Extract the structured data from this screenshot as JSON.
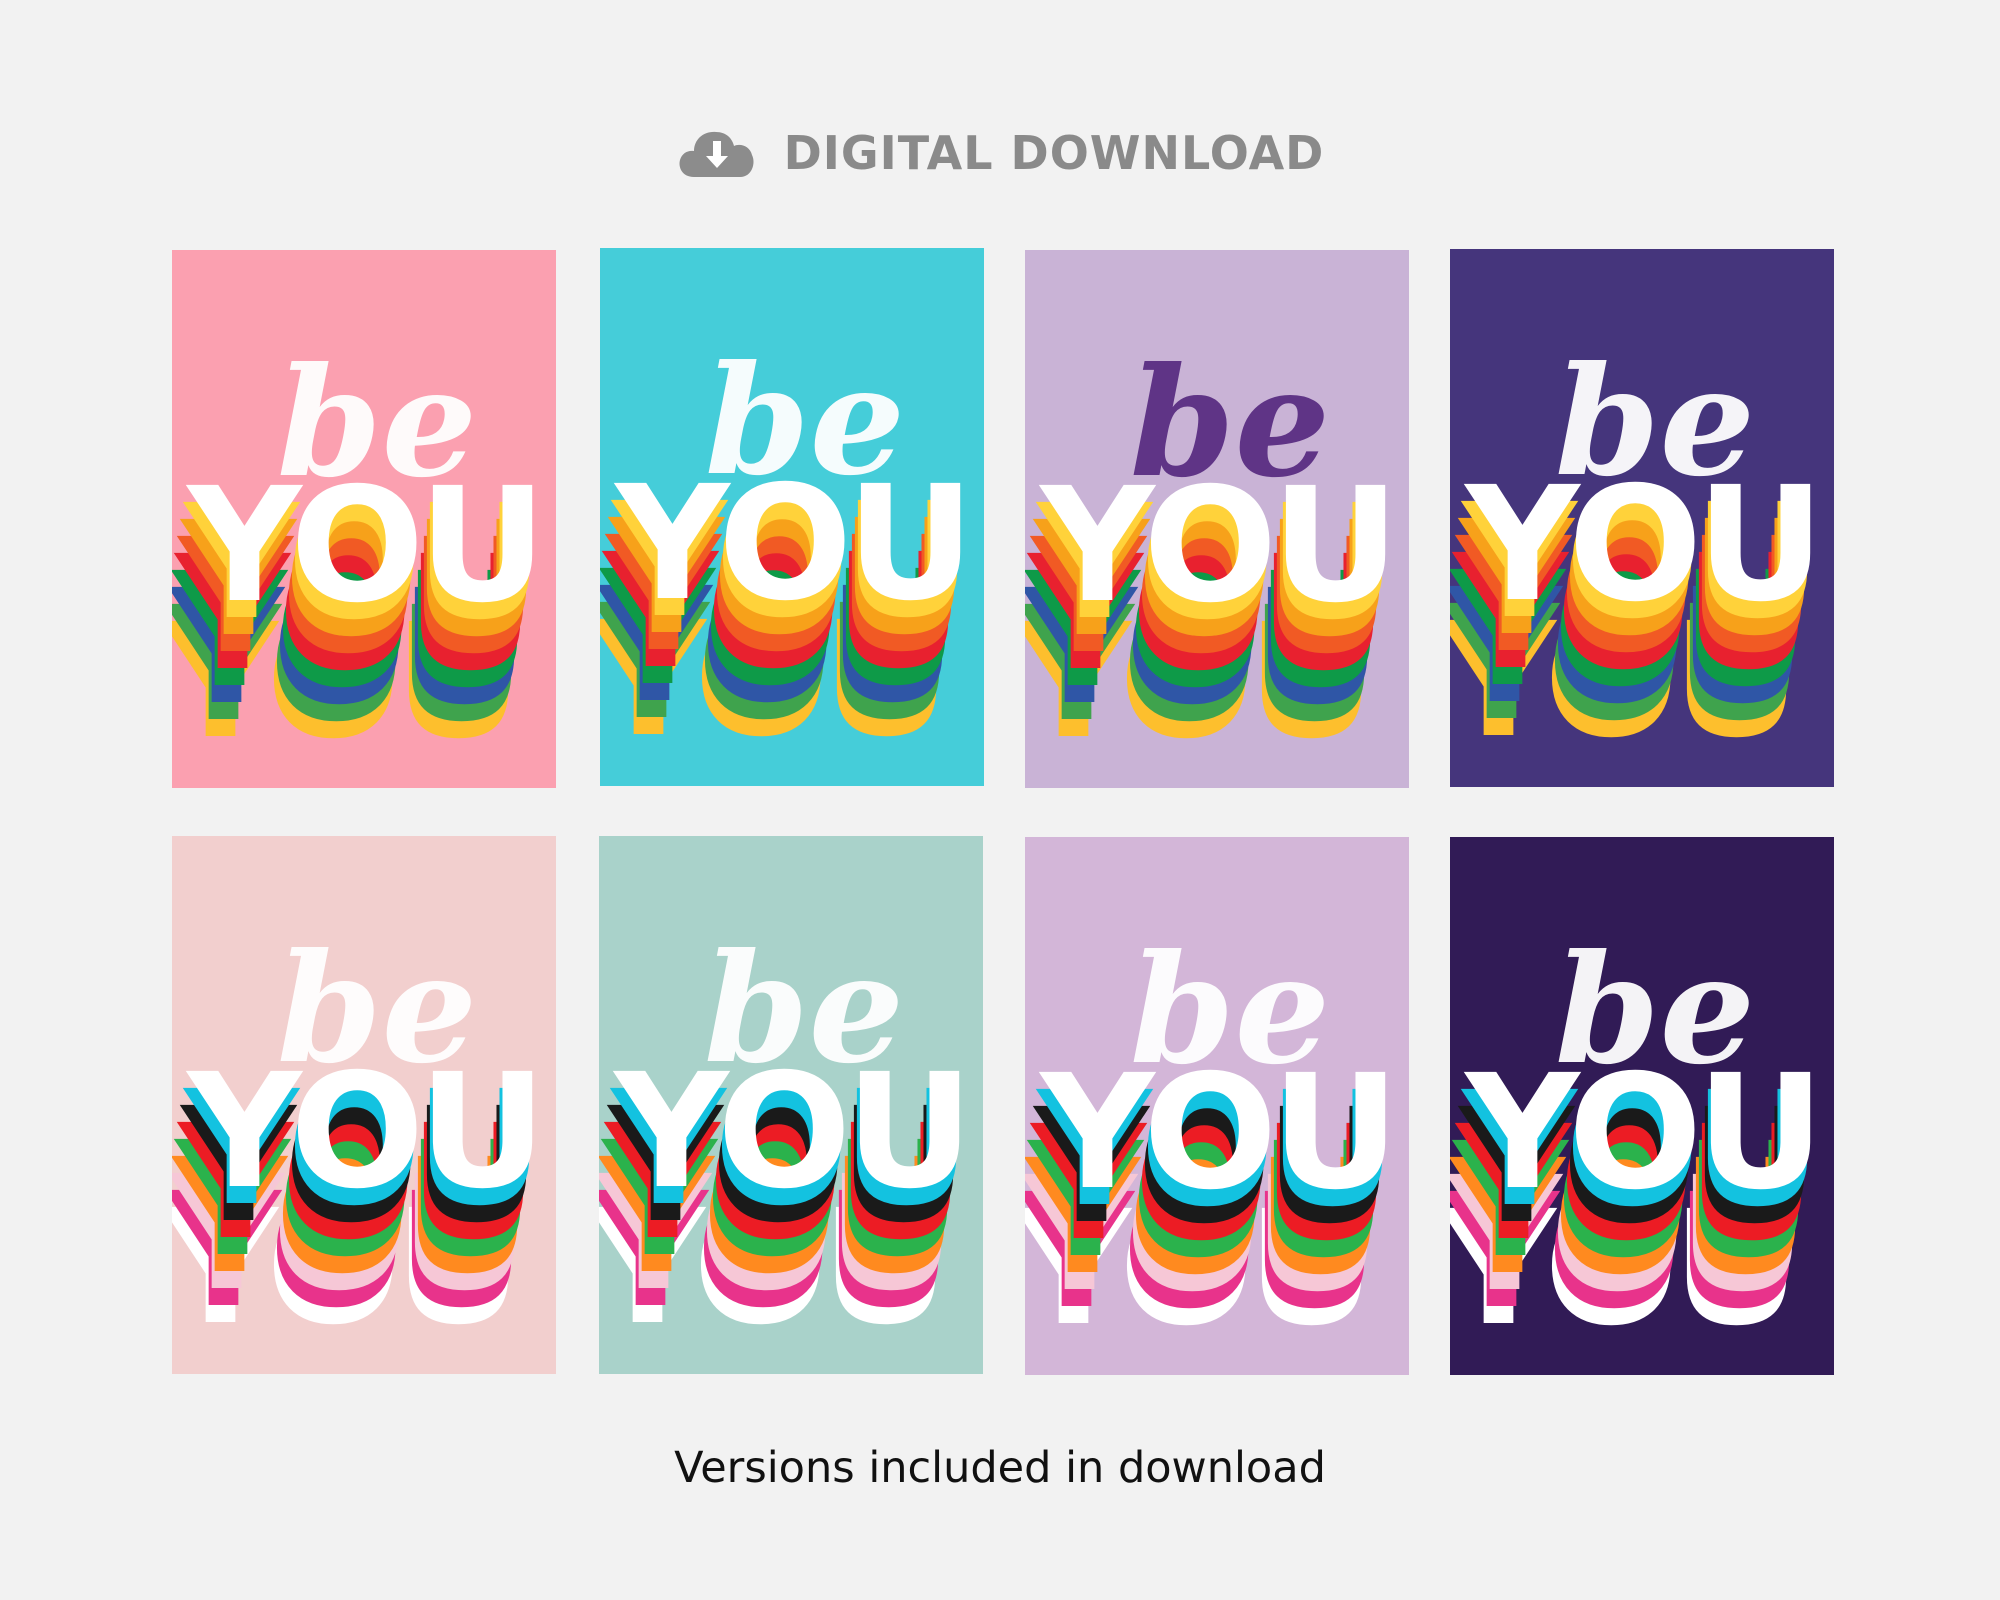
{
  "header": {
    "icon": "cloud-download-icon",
    "title": "DIGITAL DOWNLOAD",
    "icon_color": "#8c8c8c"
  },
  "cards": [
    {
      "bg": "#fba0b0",
      "script_text": "be",
      "main_text": "YOU",
      "script_color": "#ffffff",
      "stripes": "rainbow"
    },
    {
      "bg": "#45cdd9",
      "script_text": "be",
      "main_text": "YOU",
      "script_color": "#ffffff",
      "stripes": "rainbow"
    },
    {
      "bg": "#c9b3d6",
      "script_text": "be",
      "main_text": "YOU",
      "script_color": "#5a2e82",
      "stripes": "rainbow"
    },
    {
      "bg": "#45357c",
      "script_text": "be",
      "main_text": "YOU",
      "script_color": "#ffffff",
      "stripes": "rainbow"
    },
    {
      "bg": "#f2cfce",
      "script_text": "be",
      "main_text": "YOU",
      "script_color": "#ffffff",
      "stripes": "pink"
    },
    {
      "bg": "#a9d2ca",
      "script_text": "be",
      "main_text": "YOU",
      "script_color": "#ffffff",
      "stripes": "pink"
    },
    {
      "bg": "#d3b6d8",
      "script_text": "be",
      "main_text": "YOU",
      "script_color": "#ffffff",
      "stripes": "pink"
    },
    {
      "bg": "#311b56",
      "script_text": "be",
      "main_text": "YOU",
      "script_color": "#ffffff",
      "stripes": "pink"
    }
  ],
  "palettes": {
    "rainbow": [
      "#ffd23a",
      "#f7a11a",
      "#f15a24",
      "#e8212f",
      "#0e9a48",
      "#2f56a6",
      "#3fa34d",
      "#fdbf2d"
    ],
    "pink": [
      "#13c2e0",
      "#1a1a1a",
      "#ec1c24",
      "#2bb24c",
      "#ff8a1f",
      "#f6c7d6",
      "#e8338b",
      "#ffffff"
    ]
  },
  "caption": "Versions included in download"
}
